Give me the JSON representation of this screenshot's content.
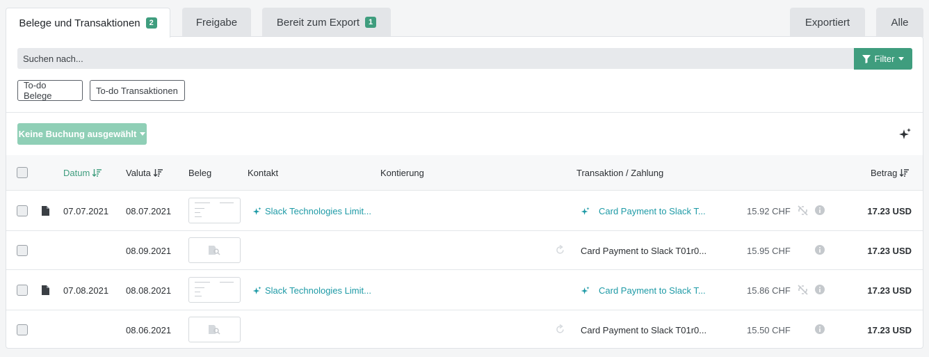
{
  "tabs": [
    {
      "label": "Belege und Transaktionen",
      "badge": "2"
    },
    {
      "label": "Freigabe"
    },
    {
      "label": "Bereit zum Export",
      "badge": "1"
    },
    {
      "label": "Exportiert"
    },
    {
      "label": "Alle"
    }
  ],
  "search": {
    "placeholder": "Suchen nach...",
    "value": ""
  },
  "filter_label": "Filter",
  "todo_buttons": [
    "To-do Belege",
    "To-do Transaktionen"
  ],
  "booking_dropdown": "Keine Buchung ausgewählt",
  "columns": {
    "datum": "Datum",
    "valuta": "Valuta",
    "beleg": "Beleg",
    "kontakt": "Kontakt",
    "kontierung": "Kontierung",
    "transaktion": "Transaktion / Zahlung",
    "betrag": "Betrag"
  },
  "rows": [
    {
      "datum": "07.07.2021",
      "valuta": "08.07.2021",
      "contact": "Slack Technologies Limit...",
      "transaction": "Card Payment to Slack T...",
      "chf": "15.92 CHF",
      "amount": "17.23 USD"
    },
    {
      "datum": "",
      "valuta": "08.09.2021",
      "contact": "",
      "transaction": "Card Payment to Slack T01r0...",
      "chf": "15.95 CHF",
      "amount": "17.23 USD"
    },
    {
      "datum": "07.08.2021",
      "valuta": "08.08.2021",
      "contact": "Slack Technologies Limit...",
      "transaction": "Card Payment to Slack T...",
      "chf": "15.86 CHF",
      "amount": "17.23 USD"
    },
    {
      "datum": "",
      "valuta": "08.06.2021",
      "contact": "",
      "transaction": "Card Payment to Slack T01r0...",
      "chf": "15.50 CHF",
      "amount": "17.23 USD"
    }
  ],
  "colors": {
    "accent": "#3f9d7e",
    "link": "#1e9aa6"
  }
}
